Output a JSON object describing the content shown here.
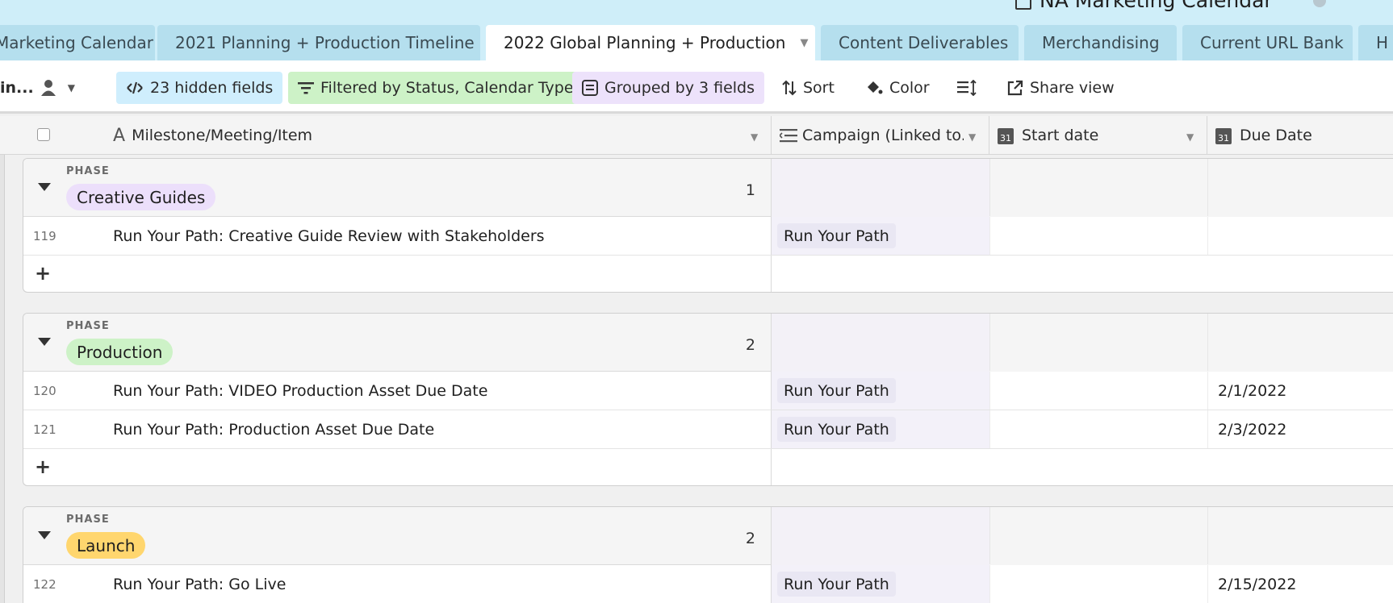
{
  "header": {
    "base_title": "NA Marketing Calendar"
  },
  "tabs": [
    {
      "label": "Marketing Calendar"
    },
    {
      "label": "2021 Planning + Production Timeline"
    },
    {
      "label": "2022 Global Planning + Production",
      "active": true
    },
    {
      "label": "Content Deliverables"
    },
    {
      "label": "Merchandising"
    },
    {
      "label": "Current URL Bank"
    },
    {
      "label": "H"
    }
  ],
  "toolbar": {
    "view_name": "in...",
    "hidden_fields": "23 hidden fields",
    "filter": "Filtered by Status, Calendar Type",
    "group": "Grouped by 3 fields",
    "sort": "Sort",
    "color": "Color",
    "share": "Share view"
  },
  "columns": {
    "primary": "Milestone/Meeting/Item",
    "campaign": "Campaign (Linked to...",
    "start": "Start date",
    "due": "Due Date"
  },
  "groups": [
    {
      "label": "PHASE",
      "name": "Creative Guides",
      "chip_color": "#ecdffb",
      "count": "1",
      "rows": [
        {
          "num": "119",
          "title": "Run Your Path: Creative Guide Review with Stakeholders",
          "campaign": "Run Your Path",
          "due": ""
        }
      ]
    },
    {
      "label": "PHASE",
      "name": "Production",
      "chip_color": "#cdf2c7",
      "count": "2",
      "rows": [
        {
          "num": "120",
          "title": "Run Your Path: VIDEO Production Asset Due Date",
          "campaign": "Run Your Path",
          "due": "2/1/2022"
        },
        {
          "num": "121",
          "title": "Run Your Path: Production Asset Due Date",
          "campaign": "Run Your Path",
          "due": "2/3/2022"
        }
      ]
    },
    {
      "label": "PHASE",
      "name": "Launch",
      "chip_color": "#ffd66e",
      "count": "2",
      "rows": [
        {
          "num": "122",
          "title": "Run Your Path: Go Live",
          "campaign": "Run Your Path",
          "due": "2/15/2022"
        }
      ]
    }
  ],
  "add_symbol": "+"
}
